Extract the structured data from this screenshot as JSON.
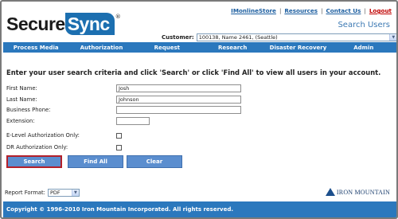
{
  "brand": {
    "logo_part1": "Secure",
    "logo_part2": "Sync",
    "logo_mark": "®",
    "sync_color": "#1c6fb0"
  },
  "top_links": {
    "link1": "IMonlineStore",
    "link2": "Resources",
    "link3": "Contact Us",
    "link4": "Logout",
    "separator": "|"
  },
  "page_heading": "Search Users",
  "customer": {
    "label": "Customer:",
    "selected": "100138, Name 2461, (Seattle)"
  },
  "nav": {
    "items": [
      "Process Media",
      "Authorization",
      "Request",
      "Research",
      "Disaster Recovery",
      "Admin"
    ]
  },
  "instructions": "Enter your user search criteria and click 'Search' or click 'Find All' to view all users in your account.",
  "form": {
    "first_name_label": "First Name:",
    "first_name_value": "Josh",
    "last_name_label": "Last Name:",
    "last_name_value": "Johnson",
    "business_phone_label": "Business Phone:",
    "business_phone_value": "",
    "extension_label": "Extension:",
    "extension_value": "",
    "e_level_label": "E-Level Authorization Only:",
    "dr_label": "DR Authorization Only:"
  },
  "buttons": {
    "search": "Search",
    "find_all": "Find All",
    "clear": "Clear"
  },
  "report": {
    "label": "Report Format:",
    "selected": "PDF"
  },
  "iron_mountain": "IRON MOUNTAIN",
  "footer": "Copyright © 1996-2010 Iron Mountain Incorporated. All rights reserved.",
  "colors": {
    "nav_blue": "#2b78bd",
    "button_blue": "#5b8ecf",
    "link_blue": "#1c5ea0",
    "logout_red": "#c00000",
    "focus_red": "#b3202a"
  }
}
